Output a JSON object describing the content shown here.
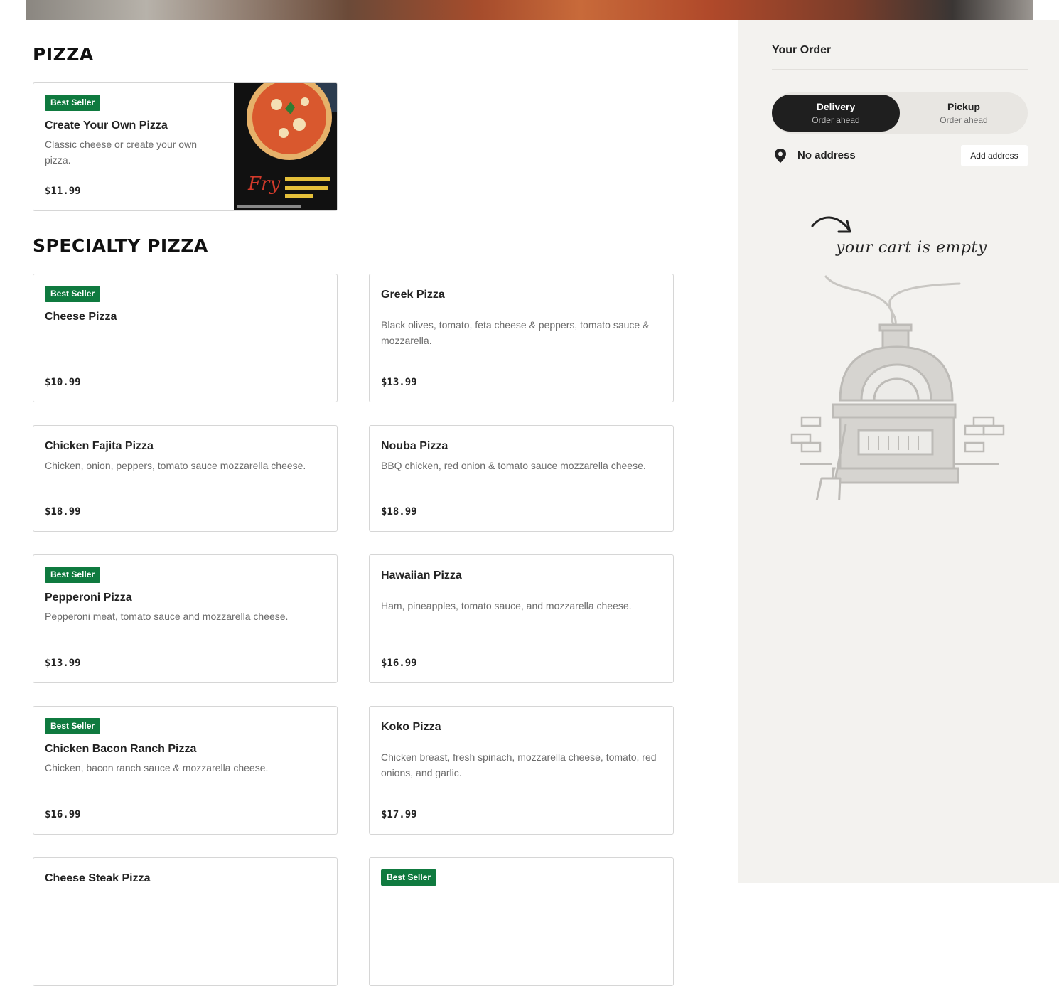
{
  "sections": [
    {
      "title": "PIZZA",
      "items": [
        {
          "badge": "Best Seller",
          "name": "Create Your Own Pizza",
          "description": "Classic cheese or create your own pizza.",
          "price": "$11.99",
          "has_image": true
        }
      ]
    },
    {
      "title": "SPECIALTY PIZZA",
      "items": [
        {
          "badge": "Best Seller",
          "name": "Cheese Pizza",
          "description": "",
          "price": "$10.99"
        },
        {
          "badge": "",
          "name": "Greek Pizza",
          "description": "Black olives, tomato, feta cheese & peppers, tomato sauce & mozzarella.",
          "price": "$13.99"
        },
        {
          "badge": "",
          "name": "Chicken Fajita Pizza",
          "description": "Chicken, onion, peppers, tomato sauce mozzarella cheese.",
          "price": "$18.99"
        },
        {
          "badge": "",
          "name": "Nouba Pizza",
          "description": "BBQ chicken, red onion & tomato sauce mozzarella cheese.",
          "price": "$18.99"
        },
        {
          "badge": "Best Seller",
          "name": "Pepperoni Pizza",
          "description": "Pepperoni meat, tomato sauce and mozzarella cheese.",
          "price": "$13.99"
        },
        {
          "badge": "",
          "name": "Hawaiian Pizza",
          "description": "Ham, pineapples, tomato sauce, and mozzarella cheese.",
          "price": "$16.99"
        },
        {
          "badge": "Best Seller",
          "name": "Chicken Bacon Ranch Pizza",
          "description": "Chicken, bacon ranch sauce & mozzarella cheese.",
          "price": "$16.99"
        },
        {
          "badge": "",
          "name": "Koko Pizza",
          "description": "Chicken breast, fresh spinach, mozzarella cheese, tomato, red onions, and garlic.",
          "price": "$17.99"
        },
        {
          "badge": "",
          "name": "Cheese Steak Pizza",
          "description": "",
          "price": ""
        },
        {
          "badge": "Best Seller",
          "name": "",
          "description": "",
          "price": ""
        }
      ]
    }
  ],
  "order": {
    "title": "Your Order",
    "delivery": {
      "label": "Delivery",
      "sub": "Order ahead"
    },
    "pickup": {
      "label": "Pickup",
      "sub": "Order ahead"
    },
    "address": "No address",
    "add_address": "Add address",
    "empty_text": "your cart is empty"
  },
  "colors": {
    "badge": "#0f7a3f",
    "sidebar_bg": "#f3f2ef",
    "toggle_active": "#1f1f1f"
  },
  "icons": {
    "address": "location-pin-icon",
    "arrow": "curved-arrow-icon",
    "oven": "pizza-oven-illustration"
  }
}
